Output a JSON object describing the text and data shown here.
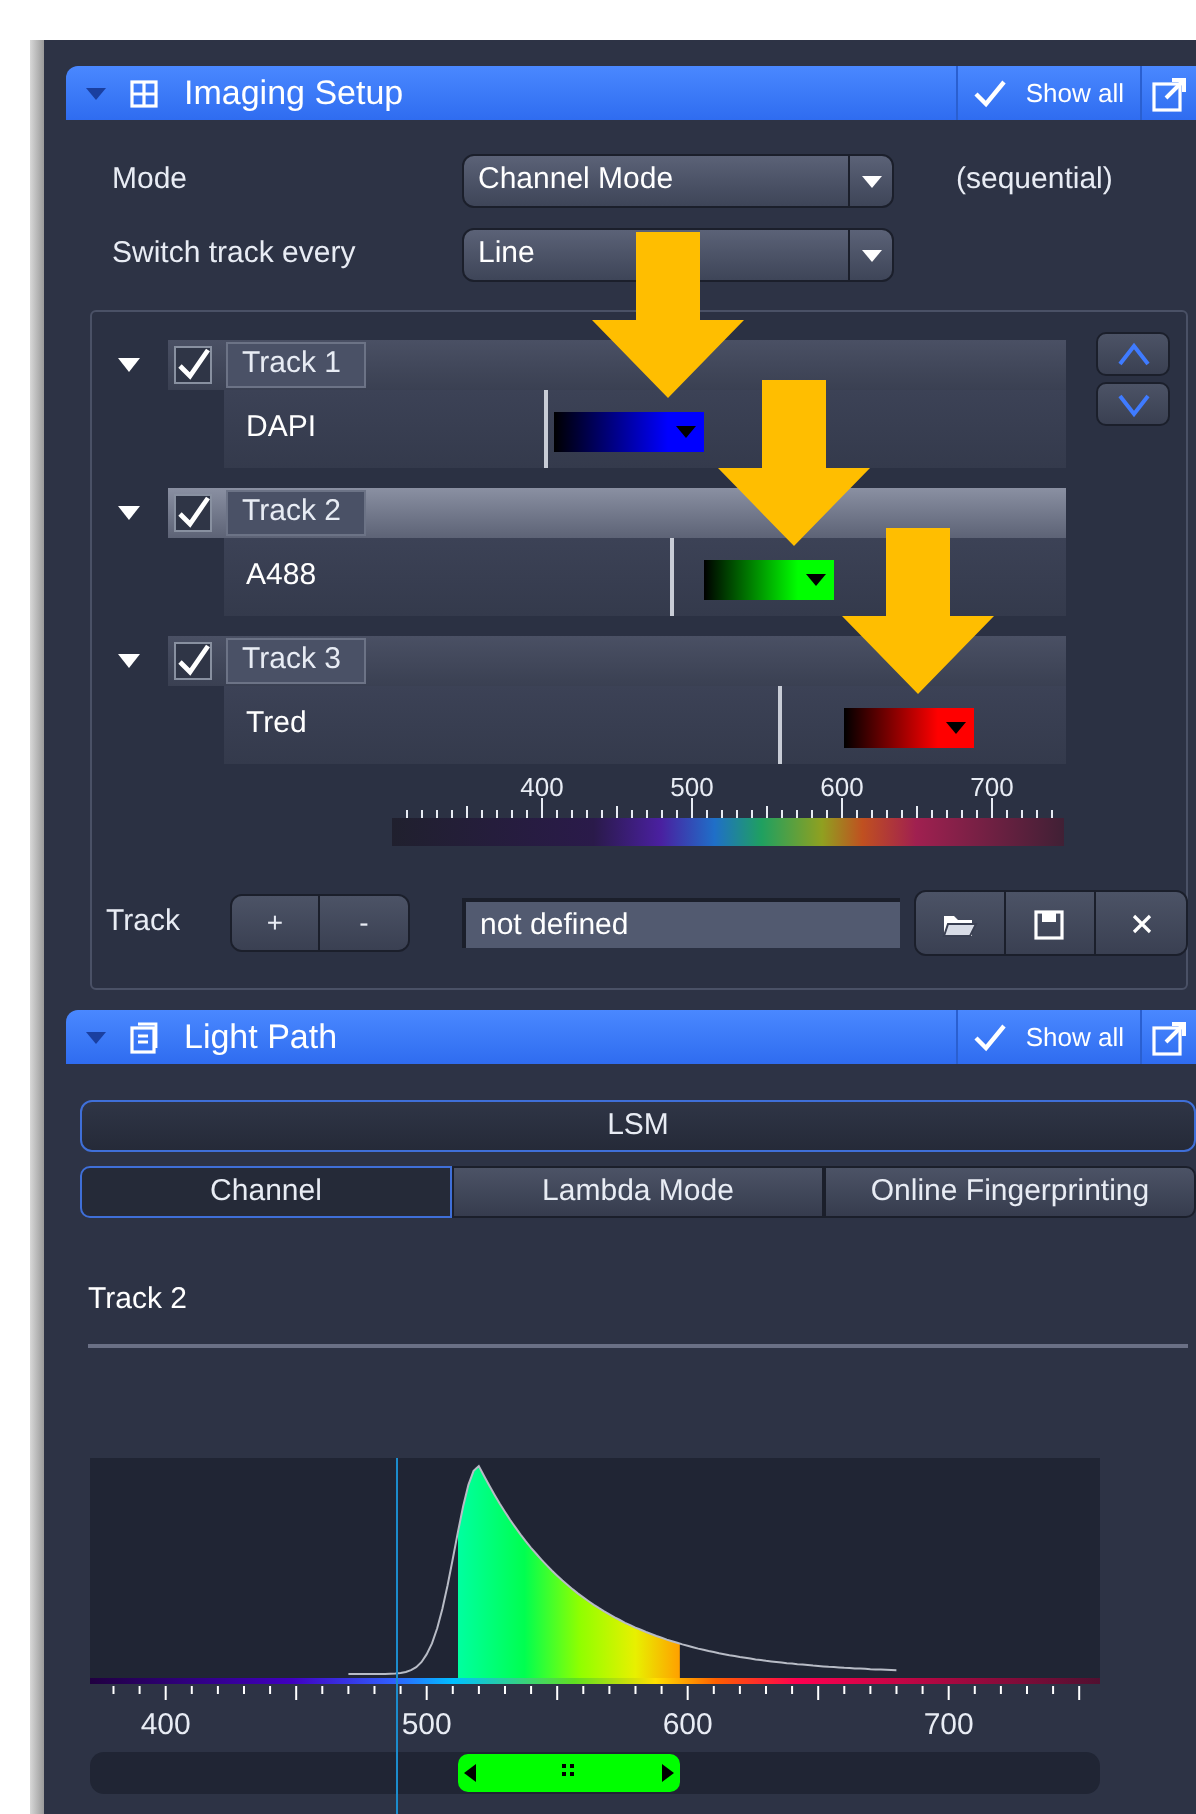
{
  "imaging_setup": {
    "title": "Imaging Setup",
    "expanded": true,
    "show_all": {
      "label": "Show all",
      "checked": true
    },
    "mode": {
      "label": "Mode",
      "value": "Channel Mode",
      "note": "(sequential)"
    },
    "switch_track": {
      "label": "Switch track every",
      "value": "Line"
    },
    "tracks": [
      {
        "name": "Track 1",
        "expanded": true,
        "checked": true,
        "selected": false,
        "channels": [
          {
            "name": "DAPI",
            "color": "#0000ff",
            "highlighted": true
          }
        ]
      },
      {
        "name": "Track 2",
        "expanded": true,
        "checked": true,
        "selected": true,
        "channels": [
          {
            "name": "A488",
            "color": "#00ff00",
            "highlighted": true
          }
        ]
      },
      {
        "name": "Track 3",
        "expanded": true,
        "checked": true,
        "selected": false,
        "channels": [
          {
            "name": "Tred",
            "color": "#ff0000",
            "highlighted": true
          }
        ]
      }
    ],
    "scale_labels": [
      "400",
      "500",
      "600",
      "700"
    ],
    "track_controls": {
      "label": "Track",
      "add": "+",
      "remove": "-",
      "config_name": "not defined"
    }
  },
  "light_path": {
    "title": "Light Path",
    "expanded": true,
    "show_all": {
      "label": "Show all",
      "checked": true
    },
    "device": "LSM",
    "tabs": [
      {
        "label": "Channel",
        "selected": true
      },
      {
        "label": "Lambda Mode",
        "selected": false
      },
      {
        "label": "Online Fingerprinting",
        "selected": false
      }
    ],
    "track_label": "Track 2",
    "axis_labels": [
      "400",
      "500",
      "600",
      "700"
    ],
    "range_slider": {
      "level": 0.474
    }
  }
}
